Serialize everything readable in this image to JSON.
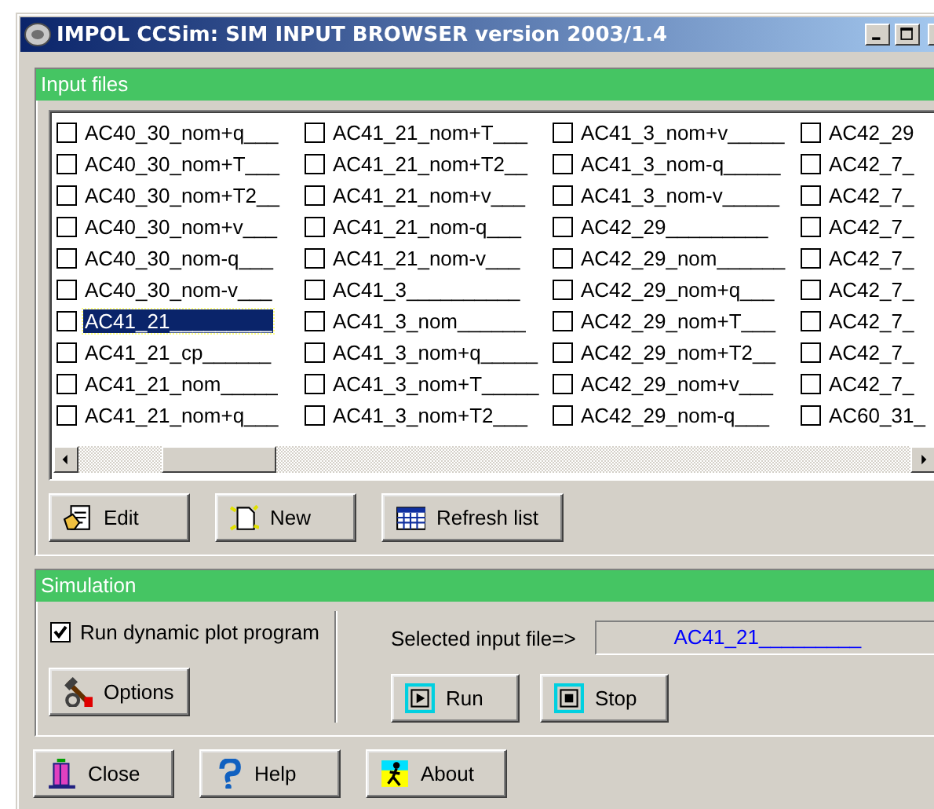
{
  "window": {
    "title": "IMPOL CCSim: SIM INPUT BROWSER version 2003/1.4"
  },
  "input_files": {
    "header": "Input files",
    "items": [
      {
        "label": "AC40_30_nom+q___",
        "checked": false,
        "selected": false
      },
      {
        "label": "AC40_30_nom+T___",
        "checked": false,
        "selected": false
      },
      {
        "label": "AC40_30_nom+T2__",
        "checked": false,
        "selected": false
      },
      {
        "label": "AC40_30_nom+v___",
        "checked": false,
        "selected": false
      },
      {
        "label": "AC40_30_nom-q___",
        "checked": false,
        "selected": false
      },
      {
        "label": "AC40_30_nom-v___",
        "checked": false,
        "selected": false
      },
      {
        "label": "AC41_21_________",
        "checked": false,
        "selected": true
      },
      {
        "label": "AC41_21_cp______",
        "checked": false,
        "selected": false
      },
      {
        "label": "AC41_21_nom_____",
        "checked": false,
        "selected": false
      },
      {
        "label": "AC41_21_nom+q___",
        "checked": false,
        "selected": false
      },
      {
        "label": "AC41_21_nom+T___",
        "checked": false,
        "selected": false
      },
      {
        "label": "AC41_21_nom+T2__",
        "checked": false,
        "selected": false
      },
      {
        "label": "AC41_21_nom+v___",
        "checked": false,
        "selected": false
      },
      {
        "label": "AC41_21_nom-q___",
        "checked": false,
        "selected": false
      },
      {
        "label": "AC41_21_nom-v___",
        "checked": false,
        "selected": false
      },
      {
        "label": "AC41_3__________",
        "checked": false,
        "selected": false
      },
      {
        "label": "AC41_3_nom______",
        "checked": false,
        "selected": false
      },
      {
        "label": "AC41_3_nom+q_____",
        "checked": false,
        "selected": false
      },
      {
        "label": "AC41_3_nom+T_____",
        "checked": false,
        "selected": false
      },
      {
        "label": "AC41_3_nom+T2___",
        "checked": false,
        "selected": false
      },
      {
        "label": "AC41_3_nom+v_____",
        "checked": false,
        "selected": false
      },
      {
        "label": "AC41_3_nom-q_____",
        "checked": false,
        "selected": false
      },
      {
        "label": "AC41_3_nom-v_____",
        "checked": false,
        "selected": false
      },
      {
        "label": "AC42_29_________",
        "checked": false,
        "selected": false
      },
      {
        "label": "AC42_29_nom______",
        "checked": false,
        "selected": false
      },
      {
        "label": "AC42_29_nom+q___",
        "checked": false,
        "selected": false
      },
      {
        "label": "AC42_29_nom+T___",
        "checked": false,
        "selected": false
      },
      {
        "label": "AC42_29_nom+T2__",
        "checked": false,
        "selected": false
      },
      {
        "label": "AC42_29_nom+v___",
        "checked": false,
        "selected": false
      },
      {
        "label": "AC42_29_nom-q___",
        "checked": false,
        "selected": false
      },
      {
        "label": "AC42_29",
        "checked": false,
        "selected": false
      },
      {
        "label": "AC42_7_",
        "checked": false,
        "selected": false
      },
      {
        "label": "AC42_7_",
        "checked": false,
        "selected": false
      },
      {
        "label": "AC42_7_",
        "checked": false,
        "selected": false
      },
      {
        "label": "AC42_7_",
        "checked": false,
        "selected": false
      },
      {
        "label": "AC42_7_",
        "checked": false,
        "selected": false
      },
      {
        "label": "AC42_7_",
        "checked": false,
        "selected": false
      },
      {
        "label": "AC42_7_",
        "checked": false,
        "selected": false
      },
      {
        "label": "AC42_7_",
        "checked": false,
        "selected": false
      },
      {
        "label": "AC60_31_",
        "checked": false,
        "selected": false
      }
    ],
    "buttons": [
      {
        "label": "Edit",
        "kind": "edit"
      },
      {
        "label": "New",
        "kind": "new"
      },
      {
        "label": "Refresh list",
        "kind": "refresh"
      }
    ]
  },
  "simulation": {
    "header": "Simulation",
    "dynamic_plot": {
      "label": "Run dynamic plot program",
      "checked": true
    },
    "options_button": {
      "label": "Options",
      "kind": "options"
    },
    "selected_file_label": "Selected input file=>",
    "selected_file_value": "AC41_21_________",
    "buttons": [
      {
        "label": "Run",
        "kind": "run"
      },
      {
        "label": "Stop",
        "kind": "stop"
      }
    ]
  },
  "footer_buttons": [
    {
      "label": "Close",
      "kind": "close"
    },
    {
      "label": "Help",
      "kind": "help"
    },
    {
      "label": "About",
      "kind": "about"
    }
  ]
}
